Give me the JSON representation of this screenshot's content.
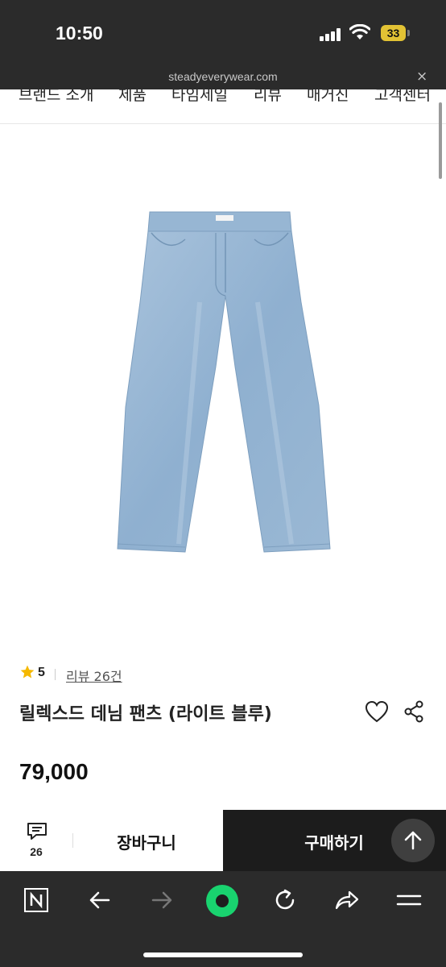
{
  "status_bar": {
    "time": "10:50",
    "battery": "33"
  },
  "url_bar": {
    "url": "steadyeverywear.com",
    "close_label": "×"
  },
  "top_nav": {
    "items": [
      "브랜드 소개",
      "제품",
      "타임세일",
      "리뷰",
      "매거진",
      "고객센터"
    ]
  },
  "product": {
    "rating": "5",
    "review_link": "리뷰 26건",
    "name": "릴렉스드 데님 팬츠 (라이트 블루)",
    "price": "79,000",
    "image": "light-blue-denim-pants"
  },
  "bottom_bar": {
    "chat_count": "26",
    "cart_label": "장바구니",
    "buy_label": "구매하기"
  },
  "colors": {
    "star": "#f5b800",
    "dark_bar": "#1c1c1c",
    "browser_accent": "#19d36f",
    "battery": "#e2c234"
  },
  "browser_toolbar": {
    "icons": [
      "naver-n-icon",
      "back-arrow-icon",
      "forward-arrow-icon",
      "home-dot-icon",
      "reload-icon",
      "share-arrow-icon",
      "menu-icon"
    ]
  }
}
